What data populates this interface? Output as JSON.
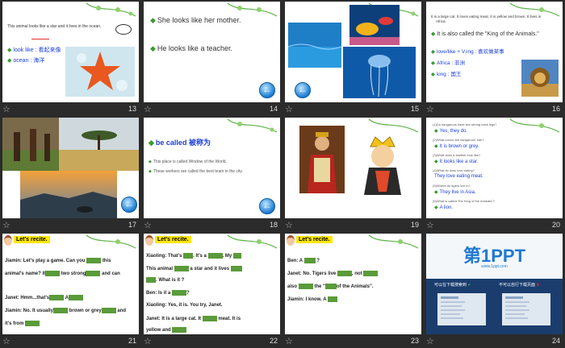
{
  "slides": {
    "s13": {
      "num": "13",
      "text1": "This animal looks like a star and it lives in the ocean.",
      "item1": "look like : 看起来像",
      "item2": "ocean : 海洋"
    },
    "s14": {
      "num": "14",
      "line1": "She looks like her mother.",
      "line2": "He looks like a teacher."
    },
    "s15": {
      "num": "15"
    },
    "s16": {
      "num": "16",
      "text1": "It is a large cat. It loves eating meat. It is yellow and brown. It lives in",
      "text2": "Africa.",
      "line3": "It is also called the \"King of the Animals.\"",
      "item1": "love/like + V-ing : 喜欢做某事",
      "item2": "Africa : 非洲",
      "item3": "king : 国王"
    },
    "s17": {
      "num": "17"
    },
    "s18": {
      "num": "18",
      "title": "be called 被称为",
      "ex1": "This place is called Window of the World.",
      "ex2": "These workers are called the best team in the city."
    },
    "s19": {
      "num": "19"
    },
    "s20": {
      "num": "20",
      "q1": "(1)Do kangaroos have two strong back legs?",
      "a1": "Yes, they do.",
      "q2": "(2)What colour are kangaroos' hair?",
      "a2": "It is brown or grey.",
      "q3": "(3)What does a starfish look like?",
      "a3": "It looks like a star.",
      "q4": "(4)What do lions love eating?",
      "a4": "They love eating meat.",
      "q5": "(5)Where do tigers live in?",
      "a5": "They live in Asia.",
      "q6": "(6)What is called \"the King of the Animals\"?",
      "a6": "A lion."
    },
    "s21": {
      "num": "21",
      "heading": "Let's recite.",
      "l1": "Jiamin: Let's play a game. Can you",
      "l1b": "this",
      "l2": "animal's name? It",
      "l2b": "two strong",
      "l2c": "and can",
      "l3": "Janet: Hmm...that's",
      "l3b": "A",
      "l4": "Jiamin: No. It usually",
      "l4b": "brown or grey",
      "l4c": "and",
      "l5": "it's from"
    },
    "s22": {
      "num": "22",
      "heading": "Let's recite.",
      "l1": "Xiaoling: That's",
      "l1b": ". It's a",
      "l1c": ". My",
      "l2": "This animal",
      "l2b": "a star and it lives",
      "l3": ". What is it ?",
      "l4": "Ben: Is it a",
      "l4b": "?",
      "l5": "Xiaoling: Yes, it is. You try, Janet.",
      "l6": "Janet: It is a large cat. It",
      "l6b": "meat. It is",
      "l7": "yellow and"
    },
    "s23": {
      "num": "23",
      "heading": "Let's recite.",
      "l1": "Ben: A",
      "l1b": "?",
      "l2": "Janet: No. Tigers live",
      "l2b": ", not",
      "l3": "also",
      "l3b": "the \"",
      "l3c": "of the Animals\".",
      "l4": "Jiamin: I know. A"
    },
    "s24": {
      "num": "24",
      "logo": "第1PPT",
      "url": "www.1ppt.com",
      "promo1": "可以在下载搜索到",
      "promo2": "不可以自行下载页面"
    }
  }
}
